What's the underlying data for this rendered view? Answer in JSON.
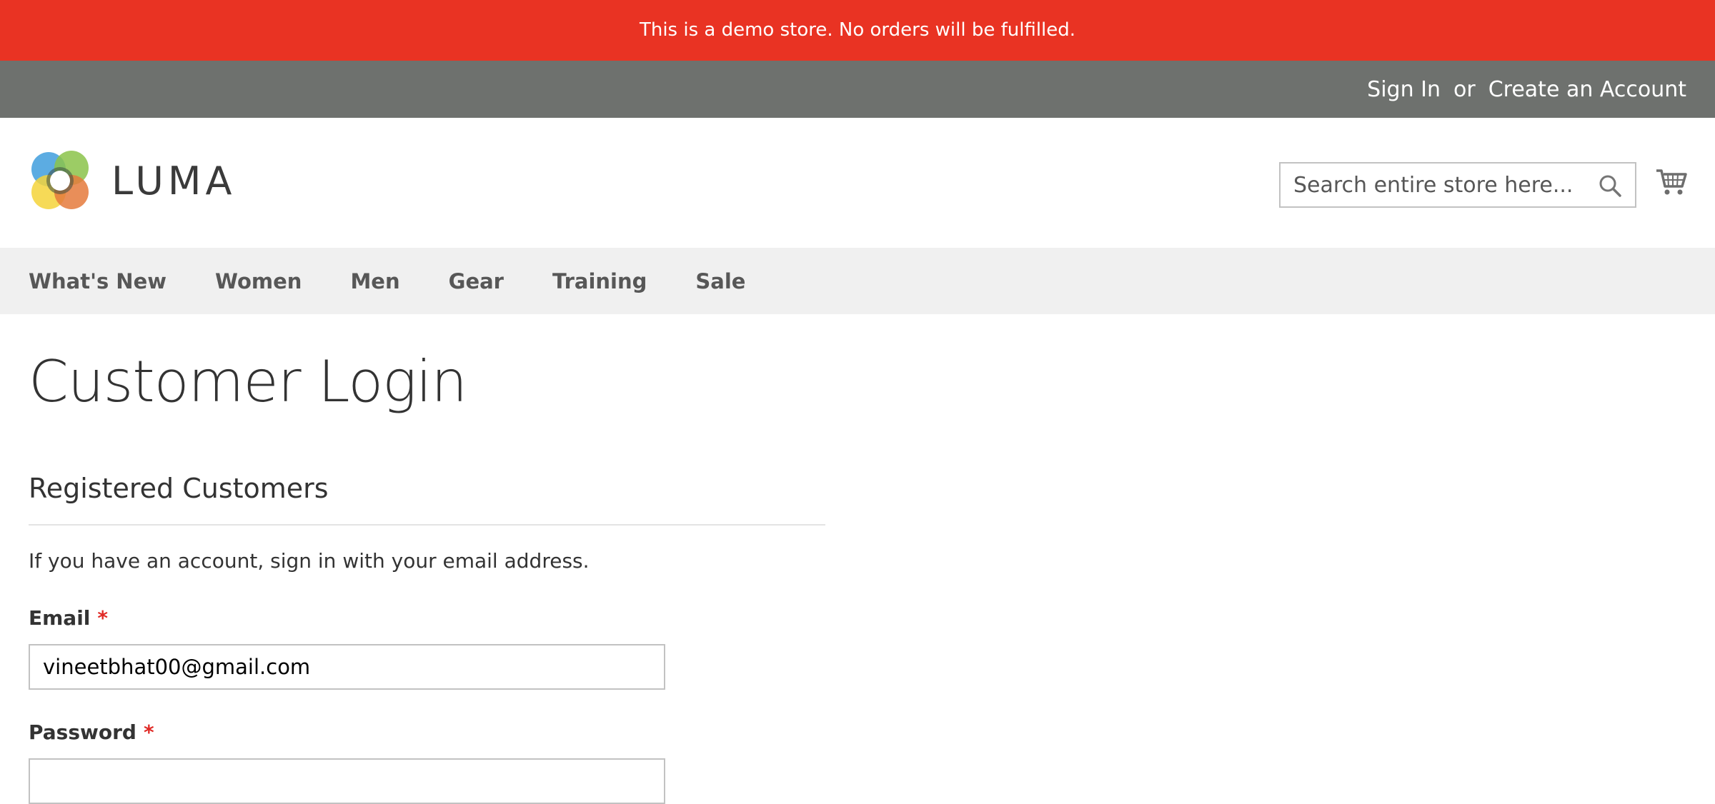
{
  "demo_notice": "This is a demo store. No orders will be fulfilled.",
  "header_links": {
    "sign_in": "Sign In",
    "separator": "or",
    "create_account": "Create an Account"
  },
  "brand": {
    "name": "LUMA",
    "colors": [
      "#4aa3df",
      "#8bc34a",
      "#f5d43a",
      "#e57a3c"
    ]
  },
  "search": {
    "placeholder": "Search entire store here...",
    "icon": "search-icon"
  },
  "cart": {
    "icon": "shopping-cart-icon"
  },
  "nav": {
    "items": [
      "What's New",
      "Women",
      "Men",
      "Gear",
      "Training",
      "Sale"
    ]
  },
  "page": {
    "title": "Customer Login"
  },
  "login_block": {
    "title": "Registered Customers",
    "intro": "If you have an account, sign in with your email address.",
    "email_label": "Email",
    "email_value": "vineetbhat00@gmail.com",
    "password_label": "Password",
    "required_marker": "*"
  },
  "colors": {
    "banner": "#e93323",
    "panel": "#6e716e",
    "nav_bg": "#f0f0f0",
    "required": "#e02b27"
  }
}
